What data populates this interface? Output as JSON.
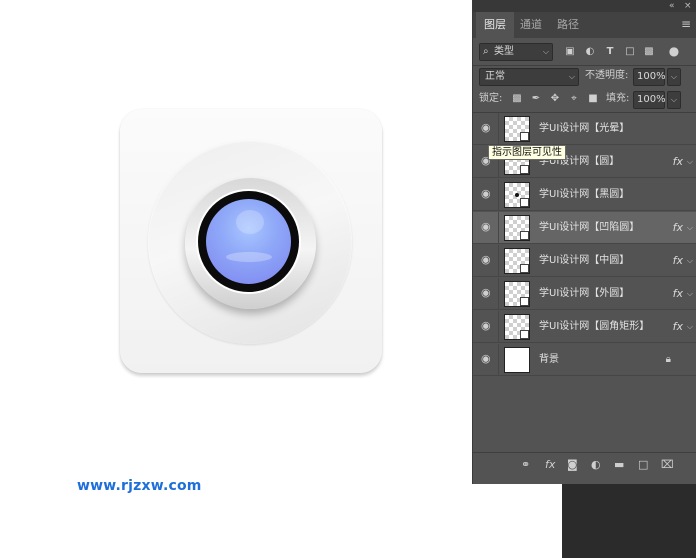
{
  "canvas": {
    "watermark": "www.rjzxw.com"
  },
  "panel": {
    "topbar": {
      "collapse": "«",
      "close": "×"
    },
    "tabs": [
      {
        "label": "图层",
        "active": true
      },
      {
        "label": "通道",
        "active": false
      },
      {
        "label": "路径",
        "active": false
      }
    ],
    "menu_icon": "≡",
    "filter": {
      "prefix": "⌕",
      "kind": "类型"
    },
    "blend_mode": "正常",
    "opacity_label": "不透明度:",
    "opacity_value": "100%",
    "lock_label": "锁定:",
    "fill_label": "填充:",
    "fill_value": "100%",
    "tooltip": "指示图层可见性",
    "layers": [
      {
        "name": "学UI设计网【光晕】",
        "fx": "",
        "selected": false
      },
      {
        "name": "学UI设计网【圆】",
        "fx": "fx",
        "selected": false
      },
      {
        "name": "学UI设计网【黑圆】",
        "fx": "",
        "selected": false
      },
      {
        "name": "学UI设计网【凹陷圆】",
        "fx": "fx",
        "selected": true
      },
      {
        "name": "学UI设计网【中圆】",
        "fx": "fx",
        "selected": false
      },
      {
        "name": "学UI设计网【外圆】",
        "fx": "fx",
        "selected": false
      },
      {
        "name": "学UI设计网【圆角矩形】",
        "fx": "fx",
        "selected": false
      },
      {
        "name": "背景",
        "fx": "",
        "selected": false
      }
    ],
    "fx_text": "fx",
    "bottom": {
      "link": "⚭",
      "fx": "fx",
      "mask": "◙",
      "adjust": "◐",
      "group": "▬",
      "new": "□",
      "delete": "⌧"
    }
  }
}
